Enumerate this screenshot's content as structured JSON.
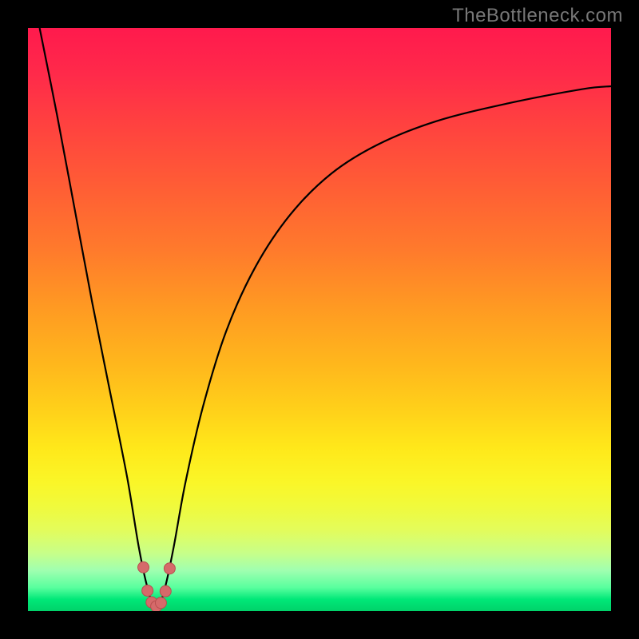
{
  "watermark": {
    "text": "TheBottleneck.com"
  },
  "colors": {
    "frame": "#000000",
    "curve_stroke": "#000000",
    "marker_fill": "#d56a6a",
    "marker_stroke": "#b84f4f",
    "watermark": "#777777"
  },
  "chart_data": {
    "type": "line",
    "title": "",
    "xlabel": "",
    "ylabel": "",
    "xlim": [
      0,
      100
    ],
    "ylim": [
      0,
      100
    ],
    "grid": false,
    "background_gradient": {
      "orientation": "vertical",
      "stops": [
        {
          "pos": 0.0,
          "color": "#ff1a4d"
        },
        {
          "pos": 0.4,
          "color": "#ff8a28"
        },
        {
          "pos": 0.7,
          "color": "#ffe81a"
        },
        {
          "pos": 0.9,
          "color": "#c8ff88"
        },
        {
          "pos": 1.0,
          "color": "#00d26a"
        }
      ],
      "meaning": "top=high bottleneck (bad, red) → bottom=low bottleneck (good, green)"
    },
    "series": [
      {
        "name": "bottleneck-curve",
        "description": "V-shaped bottleneck curve; minimum near x≈22 at y≈0; left branch rises steeply to top-left, right branch rises with decreasing slope toward top-right.",
        "x": [
          2,
          5,
          8,
          11,
          14,
          17,
          19,
          20.5,
          22,
          23.5,
          25,
          27,
          30,
          34,
          39,
          45,
          52,
          60,
          70,
          82,
          95,
          100
        ],
        "y": [
          100,
          85,
          69,
          53,
          38,
          23,
          11,
          4,
          0,
          4,
          11,
          22,
          35,
          48,
          59,
          68,
          75,
          80,
          84,
          87,
          89.5,
          90
        ]
      }
    ],
    "markers": {
      "name": "minimum-cluster",
      "description": "Small cluster of pink/red dots marking the curve minimum (optimal / no-bottleneck zone).",
      "points": [
        {
          "x": 19.8,
          "y": 7.5
        },
        {
          "x": 20.5,
          "y": 3.5
        },
        {
          "x": 21.2,
          "y": 1.5
        },
        {
          "x": 22.0,
          "y": 0.8
        },
        {
          "x": 22.8,
          "y": 1.4
        },
        {
          "x": 23.6,
          "y": 3.4
        },
        {
          "x": 24.3,
          "y": 7.3
        }
      ],
      "radius": 7
    }
  }
}
